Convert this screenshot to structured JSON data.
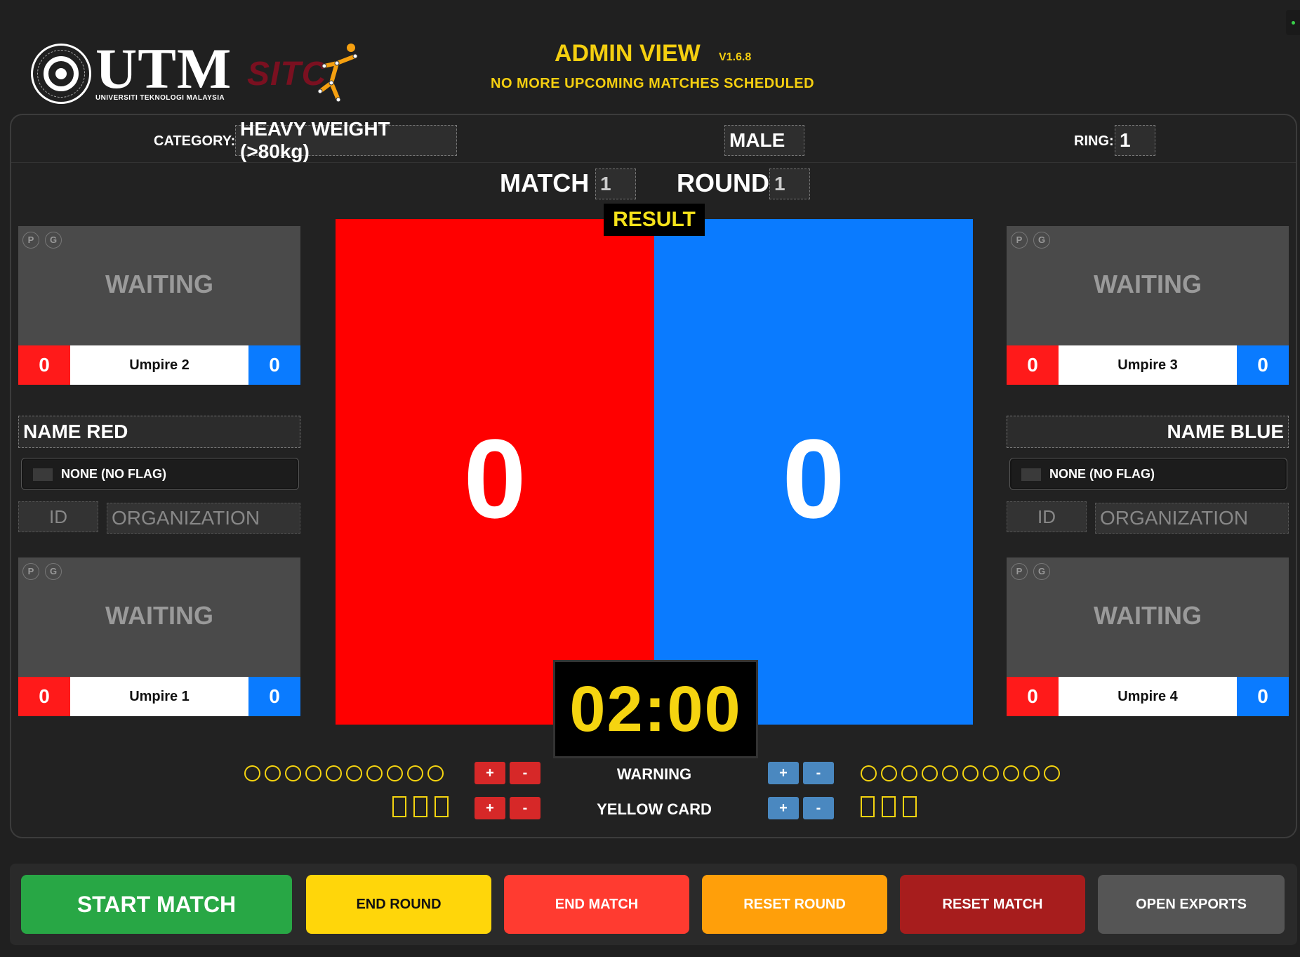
{
  "header": {
    "utm_word": "UTM",
    "utm_sub": "UNIVERSITI TEKNOLOGI MALAYSIA",
    "sitc_word": "SITC",
    "title": "ADMIN VIEW",
    "version": "V1.6.8",
    "status": "NO MORE UPCOMING MATCHES SCHEDULED"
  },
  "meta": {
    "category_label": "CATEGORY:",
    "category_value": "HEAVY WEIGHT (>80kg)",
    "gender_value": "MALE",
    "ring_label": "RING:",
    "ring_value": "1",
    "match_label": "MATCH",
    "match_value": "1",
    "round_label": "ROUND",
    "round_value": "1"
  },
  "scoreboard": {
    "result_label": "RESULT",
    "red_score": "0",
    "blue_score": "0",
    "timer": "02:00"
  },
  "umpires": [
    {
      "name": "Umpire 2",
      "state": "WAITING",
      "red": "0",
      "blue": "0",
      "p": "P",
      "g": "G"
    },
    {
      "name": "Umpire 3",
      "state": "WAITING",
      "red": "0",
      "blue": "0",
      "p": "P",
      "g": "G"
    },
    {
      "name": "Umpire 1",
      "state": "WAITING",
      "red": "0",
      "blue": "0",
      "p": "P",
      "g": "G"
    },
    {
      "name": "Umpire 4",
      "state": "WAITING",
      "red": "0",
      "blue": "0",
      "p": "P",
      "g": "G"
    }
  ],
  "red": {
    "name": "NAME RED",
    "flag": "NONE (NO FLAG)",
    "id_placeholder": "ID",
    "org_placeholder": "ORGANIZATION"
  },
  "blue": {
    "name": "NAME BLUE",
    "flag": "NONE (NO FLAG)",
    "id_placeholder": "ID",
    "org_placeholder": "ORGANIZATION"
  },
  "penalties": {
    "warning_label": "WARNING",
    "yellow_label": "YELLOW CARD",
    "plus": "+",
    "minus": "-",
    "red_warnings_max": 10,
    "blue_warnings_max": 10,
    "red_yellow_max": 3,
    "blue_yellow_max": 3
  },
  "buttons": {
    "start_match": "START MATCH",
    "end_round": "END ROUND",
    "end_match": "END MATCH",
    "reset_round": "RESET ROUND",
    "reset_match": "RESET MATCH",
    "open_exports": "OPEN EXPORTS"
  },
  "colors": {
    "red_corner": "#ff0000",
    "blue_corner": "#0a7bff",
    "accent_yellow": "#f5d410",
    "start_green": "#28a745",
    "end_round_yellow": "#ffd60a",
    "end_match_red": "#ff3b30",
    "reset_round_orange": "#ff9f0a",
    "reset_match_darkred": "#a71d1d",
    "exports_gray": "#555555"
  }
}
